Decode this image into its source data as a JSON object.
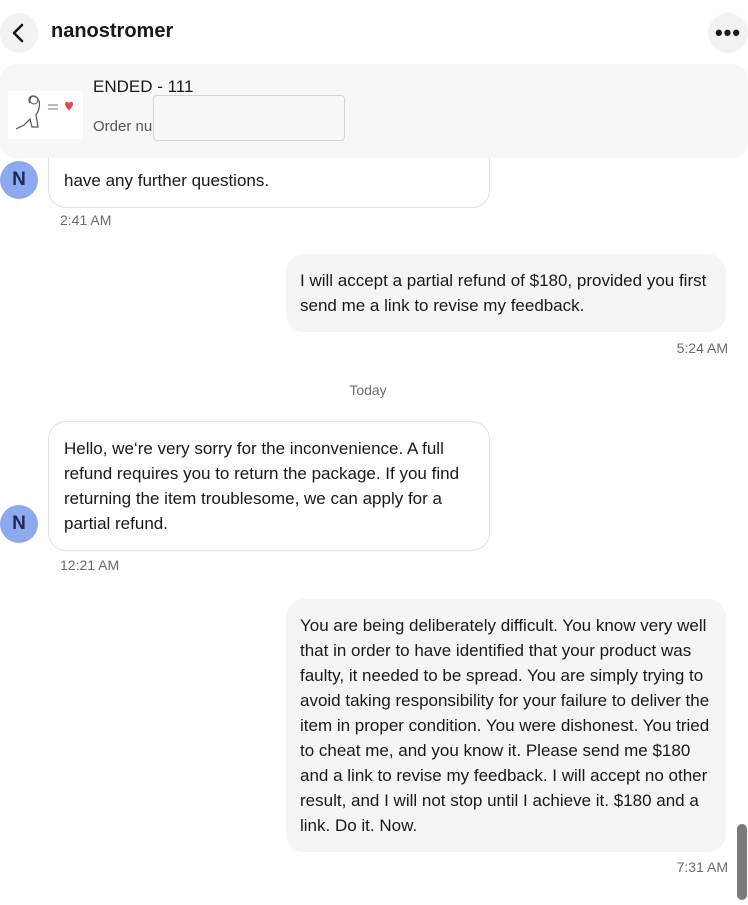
{
  "header": {
    "seller_name": "nanostromer",
    "back_icon": "chevron-left-icon",
    "more_icon": "more-horizontal-icon",
    "more_label": "•••"
  },
  "item": {
    "title": "ENDED - 111",
    "order_label": "Order nu",
    "order_input_value": ""
  },
  "messages": [
    {
      "direction": "incoming",
      "avatar_initial": "N",
      "text": "have any further questions.",
      "time": "2:41 AM"
    },
    {
      "direction": "outgoing",
      "text": "I will accept a partial refund of $180, provided you first send me a link to revise my feedback.",
      "time": "5:24 AM"
    },
    {
      "direction": "incoming",
      "avatar_initial": "N",
      "text": "Hello, we‘re very sorry for the inconvenience. A full refund requires you to return the package. If you find returning the item troublesome, we can apply for a partial refund.",
      "time": "12:21 AM"
    },
    {
      "direction": "outgoing",
      "text": "You are being deliberately difficult. You know very well that in order to have identified that your product was faulty, it needed to be spread. You are simply trying to avoid taking responsibility for your failure to deliver the item in proper condition. You were dishonest. You tried to cheat me, and you know it. Please send me $180 and a link to revise my feedback. I will accept no other result, and I will not stop until I achieve it. $180 and a link. Do it. Now.",
      "time": "7:31 AM"
    }
  ],
  "day_separator": "Today",
  "colors": {
    "avatar_bg": "#8fa9ef",
    "outgoing_bubble": "#f5f5f5",
    "incoming_border": "#e3e3e3"
  }
}
